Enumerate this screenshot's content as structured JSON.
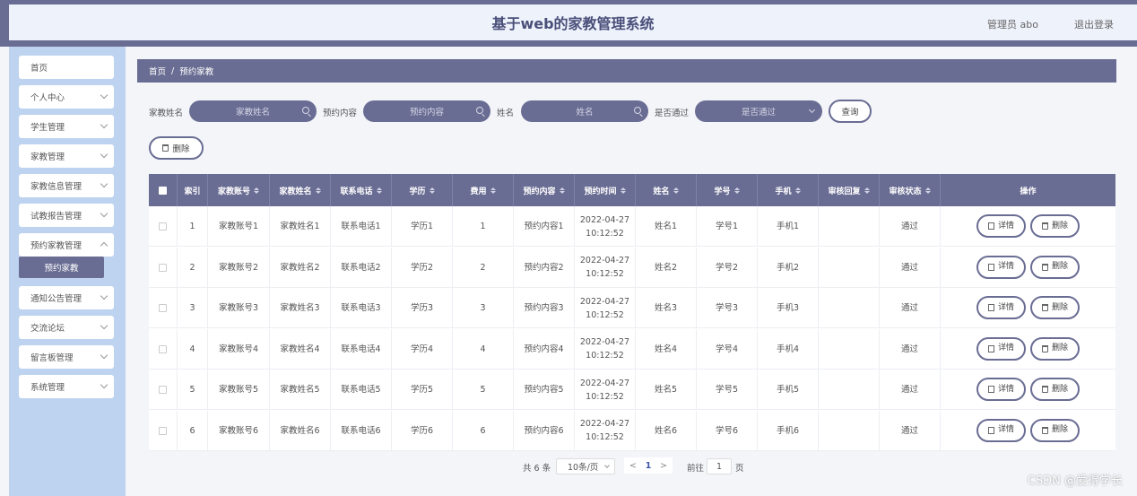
{
  "header": {
    "title": "基于web的家教管理系统",
    "user": "管理员 abo",
    "logout": "退出登录"
  },
  "sidebar": {
    "items": [
      {
        "label": "首页",
        "has_chevron": false
      },
      {
        "label": "个人中心",
        "has_chevron": true
      },
      {
        "label": "学生管理",
        "has_chevron": true
      },
      {
        "label": "家教管理",
        "has_chevron": true
      },
      {
        "label": "家教信息管理",
        "has_chevron": true
      },
      {
        "label": "试教报告管理",
        "has_chevron": true
      },
      {
        "label": "预约家教管理",
        "has_chevron": true
      },
      {
        "label": "通知公告管理",
        "has_chevron": true
      },
      {
        "label": "交流论坛",
        "has_chevron": true
      },
      {
        "label": "留言板管理",
        "has_chevron": true
      },
      {
        "label": "系统管理",
        "has_chevron": true
      }
    ],
    "active_sub": "预约家教"
  },
  "breadcrumb": {
    "home": "首页",
    "sep": "/",
    "current": "预约家教"
  },
  "filters": {
    "f1_label": "家教姓名",
    "f1_placeholder": "家教姓名",
    "f2_label": "预约内容",
    "f2_placeholder": "预约内容",
    "f3_label": "姓名",
    "f3_placeholder": "姓名",
    "f4_label": "是否通过",
    "f4_placeholder": "是否通过",
    "search_button": "查询"
  },
  "toolbar": {
    "delete_label": "删除"
  },
  "table": {
    "columns": [
      "索引",
      "家教账号",
      "家教姓名",
      "联系电话",
      "学历",
      "费用",
      "预约内容",
      "预约时间",
      "姓名",
      "学号",
      "手机",
      "审核回复",
      "审核状态",
      "操作"
    ],
    "rows": [
      {
        "index": "1",
        "account": "家教账号1",
        "name": "家教姓名1",
        "phone": "联系电话1",
        "edu": "学历1",
        "fee": "1",
        "content": "预约内容1",
        "date": "2022-04-27",
        "time": "10:12:52",
        "student": "姓名1",
        "sno": "学号1",
        "mobile": "手机1",
        "reply": "",
        "status": "通过"
      },
      {
        "index": "2",
        "account": "家教账号2",
        "name": "家教姓名2",
        "phone": "联系电话2",
        "edu": "学历2",
        "fee": "2",
        "content": "预约内容2",
        "date": "2022-04-27",
        "time": "10:12:52",
        "student": "姓名2",
        "sno": "学号2",
        "mobile": "手机2",
        "reply": "",
        "status": "通过"
      },
      {
        "index": "3",
        "account": "家教账号3",
        "name": "家教姓名3",
        "phone": "联系电话3",
        "edu": "学历3",
        "fee": "3",
        "content": "预约内容3",
        "date": "2022-04-27",
        "time": "10:12:52",
        "student": "姓名3",
        "sno": "学号3",
        "mobile": "手机3",
        "reply": "",
        "status": "通过"
      },
      {
        "index": "4",
        "account": "家教账号4",
        "name": "家教姓名4",
        "phone": "联系电话4",
        "edu": "学历4",
        "fee": "4",
        "content": "预约内容4",
        "date": "2022-04-27",
        "time": "10:12:52",
        "student": "姓名4",
        "sno": "学号4",
        "mobile": "手机4",
        "reply": "",
        "status": "通过"
      },
      {
        "index": "5",
        "account": "家教账号5",
        "name": "家教姓名5",
        "phone": "联系电话5",
        "edu": "学历5",
        "fee": "5",
        "content": "预约内容5",
        "date": "2022-04-27",
        "time": "10:12:52",
        "student": "姓名5",
        "sno": "学号5",
        "mobile": "手机5",
        "reply": "",
        "status": "通过"
      },
      {
        "index": "6",
        "account": "家教账号6",
        "name": "家教姓名6",
        "phone": "联系电话6",
        "edu": "学历6",
        "fee": "6",
        "content": "预约内容6",
        "date": "2022-04-27",
        "time": "10:12:52",
        "student": "姓名6",
        "sno": "学号6",
        "mobile": "手机6",
        "reply": "",
        "status": "通过"
      }
    ],
    "detail_label": "详情",
    "delete_label": "删除"
  },
  "pagination": {
    "total": "共 6 条",
    "page_size": "10条/页",
    "prev": "<",
    "current": "1",
    "next": ">",
    "goto_label": "前往",
    "goto_value": "1",
    "page_unit": "页"
  },
  "watermark": "CSDN @爱得学长",
  "colors": {
    "accent": "#6a6d93",
    "sidebar": "#bdd3ef",
    "header_bg": "#eef2fb"
  }
}
